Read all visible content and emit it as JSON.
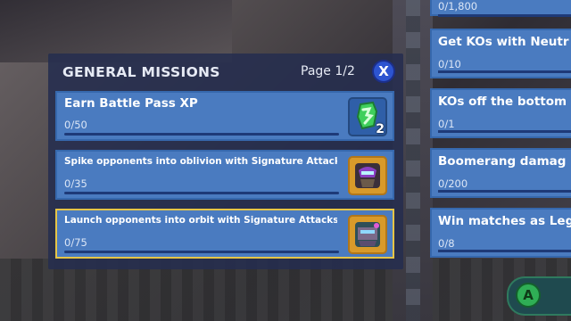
{
  "panel": {
    "title": "GENERAL MISSIONS",
    "page_indicator": "Page 1/2",
    "close_label": "X"
  },
  "missions": [
    {
      "title": "Earn Battle Pass XP",
      "progress": "0/50",
      "progress_fraction": 0,
      "reward_icon": "xp-token-icon",
      "reward_count": "2"
    },
    {
      "title": "Spike opponents into oblivion with Signature Attacks",
      "progress": "0/35",
      "progress_fraction": 0,
      "reward_icon": "character-portrait-icon"
    },
    {
      "title": "Launch opponents into orbit with Signature Attacks",
      "progress": "0/75",
      "progress_fraction": 0,
      "reward_icon": "character-portrait-icon",
      "selected": true
    }
  ],
  "right_missions": [
    {
      "title": "",
      "progress": "0/1,800"
    },
    {
      "title": "Get KOs with Neutr",
      "progress": "0/10"
    },
    {
      "title": "KOs off the bottom",
      "progress": "0/1"
    },
    {
      "title": "Boomerang damag",
      "progress": "0/200"
    },
    {
      "title": "Win matches as Leg",
      "progress": "0/8"
    }
  ],
  "confirm_button": {
    "label": "A"
  },
  "colors": {
    "panel_bg": "#262e4e",
    "mission_bg": "#4a7bc0",
    "selected_border": "#e6c547",
    "close_button": "#2d54d0",
    "confirm_button": "#2fae55"
  }
}
